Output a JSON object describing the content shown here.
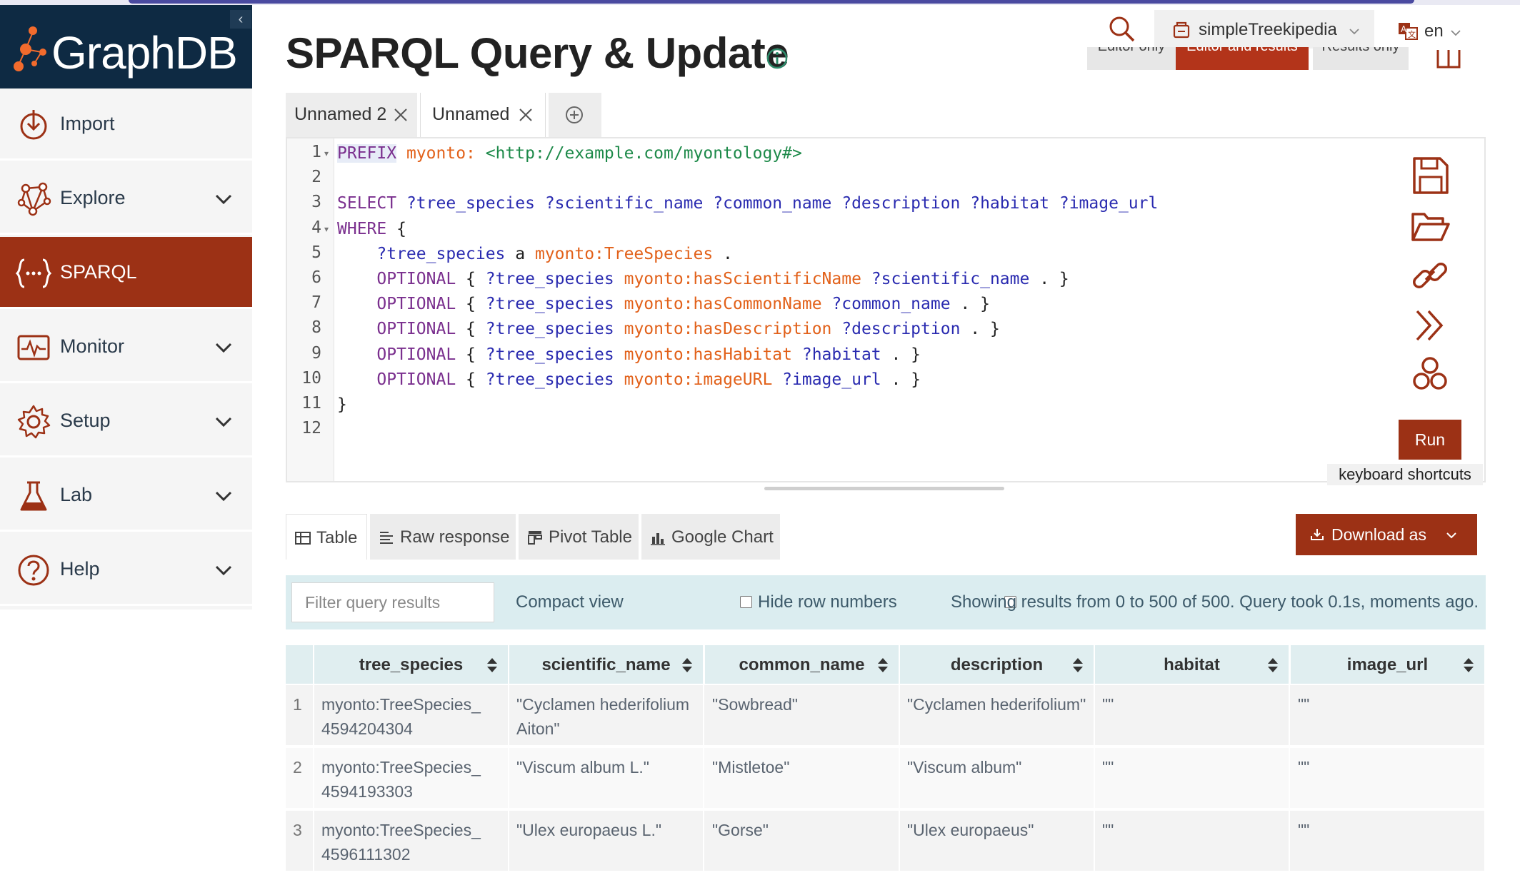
{
  "brand": {
    "name": "GraphDB"
  },
  "sidebar": {
    "items": [
      {
        "label": "Import",
        "icon": "import-icon",
        "has_submenu": false,
        "active": false
      },
      {
        "label": "Explore",
        "icon": "explore-icon",
        "has_submenu": true,
        "active": false
      },
      {
        "label": "SPARQL",
        "icon": "sparql-icon",
        "has_submenu": false,
        "active": true
      },
      {
        "label": "Monitor",
        "icon": "monitor-icon",
        "has_submenu": true,
        "active": false
      },
      {
        "label": "Setup",
        "icon": "gear-icon",
        "has_submenu": true,
        "active": false
      },
      {
        "label": "Lab",
        "icon": "flask-icon",
        "has_submenu": true,
        "active": false
      },
      {
        "label": "Help",
        "icon": "help-icon",
        "has_submenu": true,
        "active": false
      }
    ]
  },
  "header": {
    "title": "SPARQL Query & Update",
    "repository": "simpleTreekipedia",
    "language": "en",
    "view_modes": [
      "Editor only",
      "Editor and results",
      "Results only"
    ],
    "active_view_mode": "Editor and results"
  },
  "query_tabs": [
    {
      "label": "Unnamed 2",
      "active": false
    },
    {
      "label": "Unnamed",
      "active": true
    }
  ],
  "editor": {
    "lines": [
      {
        "n": "1",
        "fold": true,
        "tokens": [
          {
            "t": "PREFIX",
            "c": "tk-kw hl-kw"
          },
          {
            "t": " ",
            "c": "tk-plain"
          },
          {
            "t": "myonto:",
            "c": "tk-pfx"
          },
          {
            "t": " ",
            "c": "tk-plain"
          },
          {
            "t": "<http://example.com/myontology#>",
            "c": "tk-iri"
          }
        ]
      },
      {
        "n": "2",
        "fold": false,
        "tokens": []
      },
      {
        "n": "3",
        "fold": false,
        "tokens": [
          {
            "t": "SELECT",
            "c": "tk-kw"
          },
          {
            "t": " ",
            "c": "tk-plain"
          },
          {
            "t": "?tree_species ?scientific_name ?common_name ?description ?habitat ?image_url",
            "c": "tk-var"
          }
        ]
      },
      {
        "n": "4",
        "fold": true,
        "tokens": [
          {
            "t": "WHERE",
            "c": "tk-kw"
          },
          {
            "t": " {",
            "c": "tk-plain"
          }
        ]
      },
      {
        "n": "5",
        "fold": false,
        "tokens": [
          {
            "t": "    ",
            "c": "tk-plain"
          },
          {
            "t": "?tree_species",
            "c": "tk-var"
          },
          {
            "t": " a ",
            "c": "tk-plain"
          },
          {
            "t": "myonto:TreeSpecies",
            "c": "tk-pfx"
          },
          {
            "t": " .",
            "c": "tk-plain"
          }
        ]
      },
      {
        "n": "6",
        "fold": false,
        "tokens": [
          {
            "t": "    ",
            "c": "tk-plain"
          },
          {
            "t": "OPTIONAL",
            "c": "tk-kw"
          },
          {
            "t": " { ",
            "c": "tk-plain"
          },
          {
            "t": "?tree_species",
            "c": "tk-var"
          },
          {
            "t": " ",
            "c": "tk-plain"
          },
          {
            "t": "myonto:hasScientificName",
            "c": "tk-pfx"
          },
          {
            "t": " ",
            "c": "tk-plain"
          },
          {
            "t": "?scientific_name",
            "c": "tk-var"
          },
          {
            "t": " . }",
            "c": "tk-plain"
          }
        ]
      },
      {
        "n": "7",
        "fold": false,
        "tokens": [
          {
            "t": "    ",
            "c": "tk-plain"
          },
          {
            "t": "OPTIONAL",
            "c": "tk-kw"
          },
          {
            "t": " { ",
            "c": "tk-plain"
          },
          {
            "t": "?tree_species",
            "c": "tk-var"
          },
          {
            "t": " ",
            "c": "tk-plain"
          },
          {
            "t": "myonto:hasCommonName",
            "c": "tk-pfx"
          },
          {
            "t": " ",
            "c": "tk-plain"
          },
          {
            "t": "?common_name",
            "c": "tk-var"
          },
          {
            "t": " . }",
            "c": "tk-plain"
          }
        ]
      },
      {
        "n": "8",
        "fold": false,
        "tokens": [
          {
            "t": "    ",
            "c": "tk-plain"
          },
          {
            "t": "OPTIONAL",
            "c": "tk-kw"
          },
          {
            "t": " { ",
            "c": "tk-plain"
          },
          {
            "t": "?tree_species",
            "c": "tk-var"
          },
          {
            "t": " ",
            "c": "tk-plain"
          },
          {
            "t": "myonto:hasDescription",
            "c": "tk-pfx"
          },
          {
            "t": " ",
            "c": "tk-plain"
          },
          {
            "t": "?description",
            "c": "tk-var"
          },
          {
            "t": " . }",
            "c": "tk-plain"
          }
        ]
      },
      {
        "n": "9",
        "fold": false,
        "tokens": [
          {
            "t": "    ",
            "c": "tk-plain"
          },
          {
            "t": "OPTIONAL",
            "c": "tk-kw"
          },
          {
            "t": " { ",
            "c": "tk-plain"
          },
          {
            "t": "?tree_species",
            "c": "tk-var"
          },
          {
            "t": " ",
            "c": "tk-plain"
          },
          {
            "t": "myonto:hasHabitat",
            "c": "tk-pfx"
          },
          {
            "t": " ",
            "c": "tk-plain"
          },
          {
            "t": "?habitat",
            "c": "tk-var"
          },
          {
            "t": " . }",
            "c": "tk-plain"
          }
        ]
      },
      {
        "n": "10",
        "fold": false,
        "tokens": [
          {
            "t": "    ",
            "c": "tk-plain"
          },
          {
            "t": "OPTIONAL",
            "c": "tk-kw"
          },
          {
            "t": " { ",
            "c": "tk-plain"
          },
          {
            "t": "?tree_species",
            "c": "tk-var"
          },
          {
            "t": " ",
            "c": "tk-plain"
          },
          {
            "t": "myonto:imageURL",
            "c": "tk-pfx"
          },
          {
            "t": " ",
            "c": "tk-plain"
          },
          {
            "t": "?image_url",
            "c": "tk-var"
          },
          {
            "t": " . }",
            "c": "tk-plain"
          }
        ]
      },
      {
        "n": "11",
        "fold": false,
        "tokens": [
          {
            "t": "}",
            "c": "tk-plain"
          }
        ]
      },
      {
        "n": "12",
        "fold": false,
        "tokens": []
      }
    ],
    "tools": [
      "save-icon",
      "folder-open-icon",
      "link-icon",
      "chevrons-right-icon",
      "circles-icon"
    ],
    "run_label": "Run",
    "shortcuts_label": "keyboard shortcuts"
  },
  "result_tabs": [
    {
      "label": "Table",
      "icon": "table-icon",
      "active": true
    },
    {
      "label": "Raw response",
      "icon": "lines-icon",
      "active": false
    },
    {
      "label": "Pivot Table",
      "icon": "pivot-icon",
      "active": false
    },
    {
      "label": "Google Chart",
      "icon": "bar-chart-icon",
      "active": false
    }
  ],
  "download": {
    "label": "Download as"
  },
  "filter": {
    "placeholder": "Filter query results",
    "compact_view_label": "Compact view",
    "hide_row_numbers_label": "Hide row numbers",
    "status": "Showing results from 0 to 500 of 500. Query took 0.1s, moments ago."
  },
  "table": {
    "columns": [
      "tree_species",
      "scientific_name",
      "common_name",
      "description",
      "habitat",
      "image_url"
    ],
    "rows": [
      {
        "n": "1",
        "cells": [
          "myonto:TreeSpecies_\n4594204304",
          "\"Cyclamen hederifolium Aiton\"",
          "\"Sowbread\"",
          "\"Cyclamen hederifolium\"",
          "\"\"",
          "\"\""
        ]
      },
      {
        "n": "2",
        "cells": [
          "myonto:TreeSpecies_\n4594193303",
          "\"Viscum album L.\"",
          "\"Mistletoe\"",
          "\"Viscum album\"",
          "\"\"",
          "\"\""
        ]
      },
      {
        "n": "3",
        "cells": [
          "myonto:TreeSpecies_\n4596111302",
          "\"Ulex europaeus L.\"",
          "\"Gorse\"",
          "\"Ulex europaeus\"",
          "\"\"",
          "\"\""
        ]
      }
    ]
  },
  "colors": {
    "brand_dark": "#0e2a43",
    "accent": "#9c3115",
    "logo_orange": "#f26b2d",
    "filter_bg": "#dbedf0"
  }
}
